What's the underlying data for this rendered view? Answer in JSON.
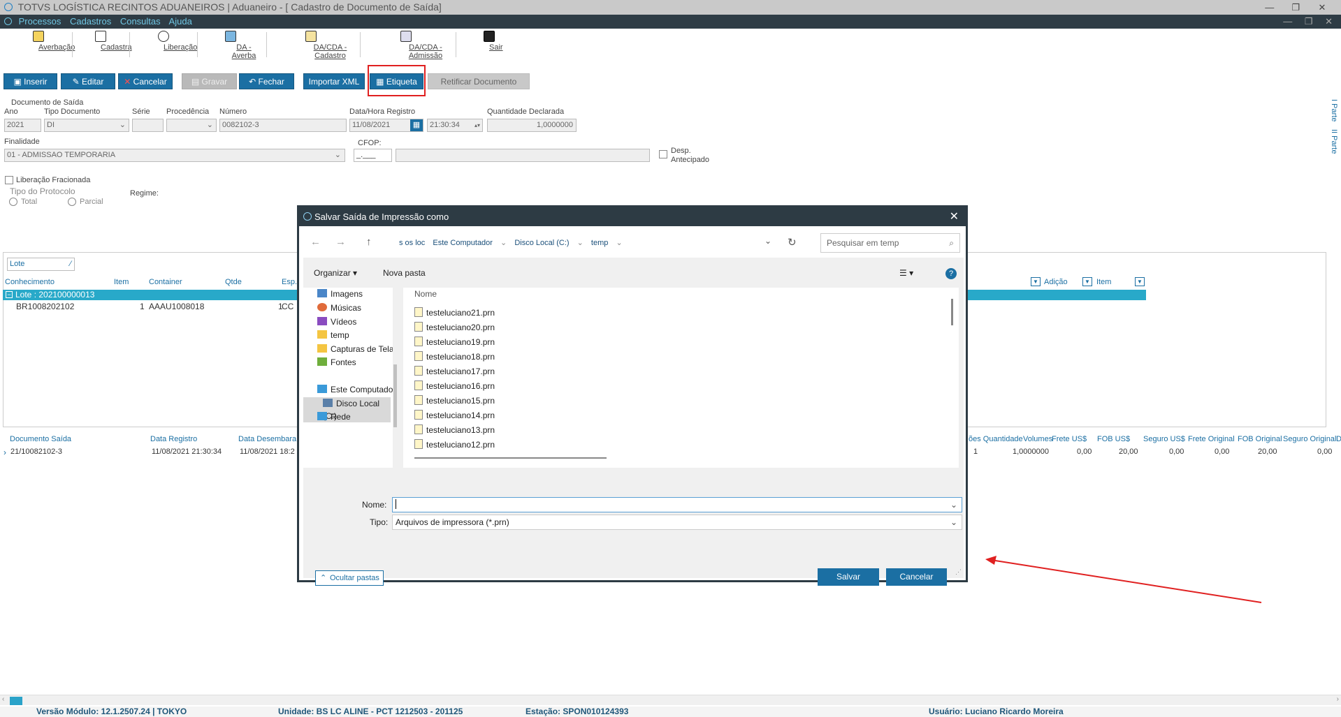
{
  "window": {
    "title": "TOTVS LOGÍSTICA RECINTOS ADUANEIROS | Aduaneiro - [ Cadastro de Documento de Saída]",
    "minimize": "—",
    "restore": "❐",
    "close": "✕"
  },
  "menu": {
    "items": [
      "Processos",
      "Cadastros",
      "Consultas",
      "Ajuda"
    ],
    "minimize": "—",
    "restore": "❐",
    "close": "✕"
  },
  "toolbar": {
    "items": [
      "Averbação",
      "Cadastra",
      "Liberação",
      "DA - Averba",
      "DA/CDA - Cadastro",
      "DA/CDA - Admissão",
      "Sair"
    ]
  },
  "actions": {
    "inserir": "Inserir",
    "editar": "Editar",
    "cancelar": "Cancelar",
    "gravar": "Gravar",
    "fechar": "Fechar",
    "importar_xml": "Importar XML",
    "etiqueta": "Etiqueta",
    "retificar": "Retificar Documento"
  },
  "form": {
    "section": "Documento de Saída",
    "ano_label": "Ano",
    "ano": "2021",
    "tipo_label": "Tipo Documento",
    "tipo": "DI",
    "serie_label": "Série",
    "procedencia_label": "Procedência",
    "numero_label": "Número",
    "numero": "0082102-3",
    "data_label": "Data/Hora Registro",
    "data": "11/08/2021",
    "hora": "21:30:34",
    "qtd_label": "Quantidade Declarada",
    "qtd": "1,0000000",
    "finalidade_label": "Finalidade",
    "finalidade": "01 - ADMISSAO TEMPORARIA",
    "cfop_label": "CFOP:",
    "cfop": "_.___",
    "desp_label_1": "Desp.",
    "desp_label_2": "Antecipado",
    "liberacao_label": "Liberação Fracionada",
    "protocolo_label": "Tipo do Protocolo",
    "total_label": "Total",
    "parcial_label": "Parcial",
    "regime_label": "Regime:",
    "side_tab_1": "I Parte",
    "side_tab_2": "II Parte"
  },
  "grid": {
    "lote_filter": "Lote",
    "headers": [
      "Conhecimento",
      "Item",
      "Container",
      "Qtde",
      "Esp."
    ],
    "headers_right": [
      "Adição",
      "Item"
    ],
    "group_label": "Lote : 202100000013",
    "row": {
      "conhecimento": "BR1008202102",
      "item": "1",
      "container": "AAAU1008018",
      "qtde": "1",
      "esp": "CC"
    }
  },
  "list": {
    "headers": [
      "Documento Saída",
      "Data Registro",
      "Data Desembara"
    ],
    "headers_right": [
      "ões Quantidade",
      "Volumes",
      "Frete US$",
      "FOB US$",
      "Seguro US$",
      "Frete Original",
      "FOB Original",
      "Seguro Original",
      "D"
    ],
    "row": {
      "documento": "21/10082102-3",
      "data_registro": "11/08/2021 21:30:34",
      "data_desemb": "11/08/2021 18:2",
      "qtd": "1",
      "volumes": "1,0000000",
      "frete": "0,00",
      "fob": "20,00",
      "seguro": "0,00",
      "frete_orig": "0,00",
      "fob_orig": "20,00",
      "seguro_orig": "0,00"
    }
  },
  "status": {
    "versao": "Versão Módulo:  12.1.2507.24  |  TOKYO",
    "unidade": "Unidade: BS LC ALINE - PCT 1212503 - 201125",
    "estacao": "Estação: SPON010124393",
    "usuario": "Usuário: Luciano Ricardo Moreira"
  },
  "dialog": {
    "title": "Salvar Saída de Impressão como",
    "close": "✕",
    "address": [
      "s os loc",
      "Este Computador",
      "Disco Local (C:)",
      "temp"
    ],
    "search_placeholder": "Pesquisar em temp",
    "organize": "Organizar ▾",
    "new_folder": "Nova pasta",
    "column_name": "Nome",
    "nav_items": [
      "Imagens",
      "Músicas",
      "Vídeos",
      "temp",
      "Capturas de Tela",
      "Fontes",
      "Este Computador",
      "Disco Local (C:)",
      "Rede"
    ],
    "files": [
      "testeluciano21.prn",
      "testeluciano20.prn",
      "testeluciano19.prn",
      "testeluciano18.prn",
      "testeluciano17.prn",
      "testeluciano16.prn",
      "testeluciano15.prn",
      "testeluciano14.prn",
      "testeluciano13.prn",
      "testeluciano12.prn"
    ],
    "nome_label": "Nome:",
    "nome_value": "",
    "tipo_label": "Tipo:",
    "tipo_value": "Arquivos de impressora (*.prn)",
    "hide_folders": "Ocultar pastas",
    "save": "Salvar",
    "cancel": "Cancelar"
  },
  "colors": {
    "accent": "#1b6fa3",
    "highlight": "#e02020",
    "group": "#28a9c9",
    "dialog_title": "#2d3b44"
  }
}
